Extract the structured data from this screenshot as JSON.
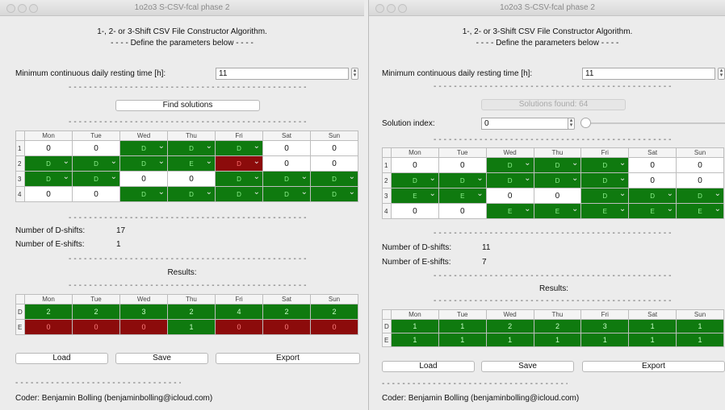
{
  "days": [
    "Mon",
    "Tue",
    "Wed",
    "Thu",
    "Fri",
    "Sat",
    "Sun"
  ],
  "colors": {
    "green": "#0f7a0f",
    "red": "#8c0b0b",
    "window": "#ececec"
  },
  "window1": {
    "title": "1o2o3 S-CSV-fcal phase 2",
    "heading": "1-, 2- or 3-Shift CSV File Constructor Algorithm.",
    "subheading": "- - - -  Define the parameters below  - - - -",
    "rest_label": "Minimum continuous daily resting time [h]:",
    "rest_value": "11",
    "find_button": "Find solutions",
    "schedule": [
      {
        "label": "1",
        "cells": [
          "0",
          "0",
          "D",
          "D",
          "D",
          "0",
          "0"
        ]
      },
      {
        "label": "2",
        "cells": [
          "D",
          "D",
          "D",
          "E",
          "D",
          "0",
          "0"
        ]
      },
      {
        "label": "3",
        "cells": [
          "D",
          "D",
          "0",
          "0",
          "D",
          "D",
          "D"
        ]
      },
      {
        "label": "4",
        "cells": [
          "0",
          "0",
          "D",
          "D",
          "D",
          "D",
          "D"
        ]
      }
    ],
    "d_label": "Number of D-shifts:",
    "d_count": "17",
    "e_label": "Number of E-shifts:",
    "e_count": "1",
    "results_label": "Results:",
    "results": [
      {
        "label": "D",
        "cells": [
          "2",
          "2",
          "3",
          "2",
          "4",
          "2",
          "2"
        ]
      },
      {
        "label": "E",
        "cells": [
          "0",
          "0",
          "0",
          "1",
          "0",
          "0",
          "0"
        ]
      }
    ],
    "load_button": "Load",
    "save_button": "Save",
    "export_button": "Export",
    "coder": "Coder: Benjamin Bolling (benjaminbolling@icloud.com)"
  },
  "window2": {
    "title": "1o2o3 S-CSV-fcal phase 2",
    "heading": "1-, 2- or 3-Shift CSV File Constructor Algorithm.",
    "subheading": "- - - -  Define the parameters below  - - - -",
    "rest_label": "Minimum continuous daily resting time [h]:",
    "rest_value": "11",
    "solutions_button": "Solutions found: 64",
    "index_label": "Solution index:",
    "index_value": "0",
    "schedule": [
      {
        "label": "1",
        "cells": [
          "0",
          "0",
          "D",
          "D",
          "D",
          "0",
          "0"
        ]
      },
      {
        "label": "2",
        "cells": [
          "D",
          "D",
          "D",
          "D",
          "D",
          "0",
          "0"
        ]
      },
      {
        "label": "3",
        "cells": [
          "E",
          "E",
          "0",
          "0",
          "D",
          "D",
          "D"
        ]
      },
      {
        "label": "4",
        "cells": [
          "0",
          "0",
          "E",
          "E",
          "E",
          "E",
          "E"
        ]
      }
    ],
    "d_label": "Number of D-shifts:",
    "d_count": "11",
    "e_label": "Number of E-shifts:",
    "e_count": "7",
    "results_label": "Results:",
    "results": [
      {
        "label": "D",
        "cells": [
          "1",
          "1",
          "2",
          "2",
          "3",
          "1",
          "1"
        ]
      },
      {
        "label": "E",
        "cells": [
          "1",
          "1",
          "1",
          "1",
          "1",
          "1",
          "1"
        ]
      }
    ],
    "load_button": "Load",
    "save_button": "Save",
    "export_button": "Export",
    "coder": "Coder: Benjamin Bolling (benjaminbolling@icloud.com)"
  }
}
